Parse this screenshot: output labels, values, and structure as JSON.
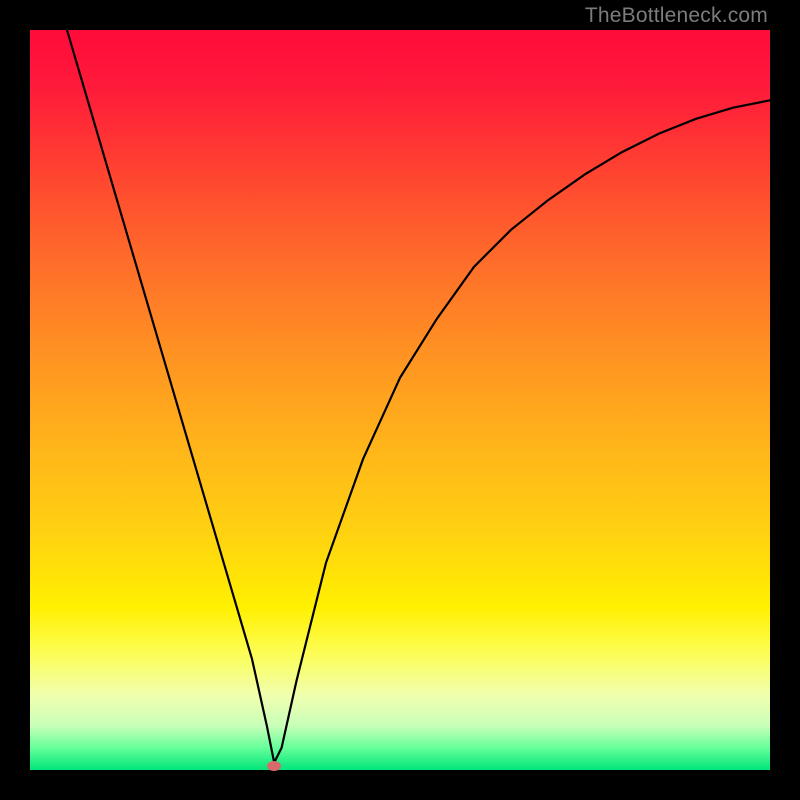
{
  "watermark": "TheBottleneck.com",
  "chart_data": {
    "type": "line",
    "title": "",
    "xlabel": "",
    "ylabel": "",
    "xlim": [
      0,
      100
    ],
    "ylim": [
      0,
      100
    ],
    "grid": false,
    "legend": false,
    "series": [
      {
        "name": "curve",
        "x": [
          5,
          10,
          15,
          20,
          25,
          30,
          32,
          33,
          34,
          36,
          40,
          45,
          50,
          55,
          60,
          65,
          70,
          75,
          80,
          85,
          90,
          95,
          100
        ],
        "y": [
          100,
          83,
          66,
          49,
          32,
          15,
          6,
          1,
          3,
          12,
          28,
          42,
          53,
          61,
          68,
          73,
          77,
          80.5,
          83.5,
          86,
          88,
          89.5,
          90.5
        ]
      }
    ],
    "marker": {
      "x": 33,
      "y": 0.5
    },
    "background_gradient_stops": [
      {
        "pct": 0,
        "color": "#ff0b3a"
      },
      {
        "pct": 50,
        "color": "#ffb41a"
      },
      {
        "pct": 80,
        "color": "#fff000"
      },
      {
        "pct": 100,
        "color": "#00e57a"
      }
    ]
  }
}
